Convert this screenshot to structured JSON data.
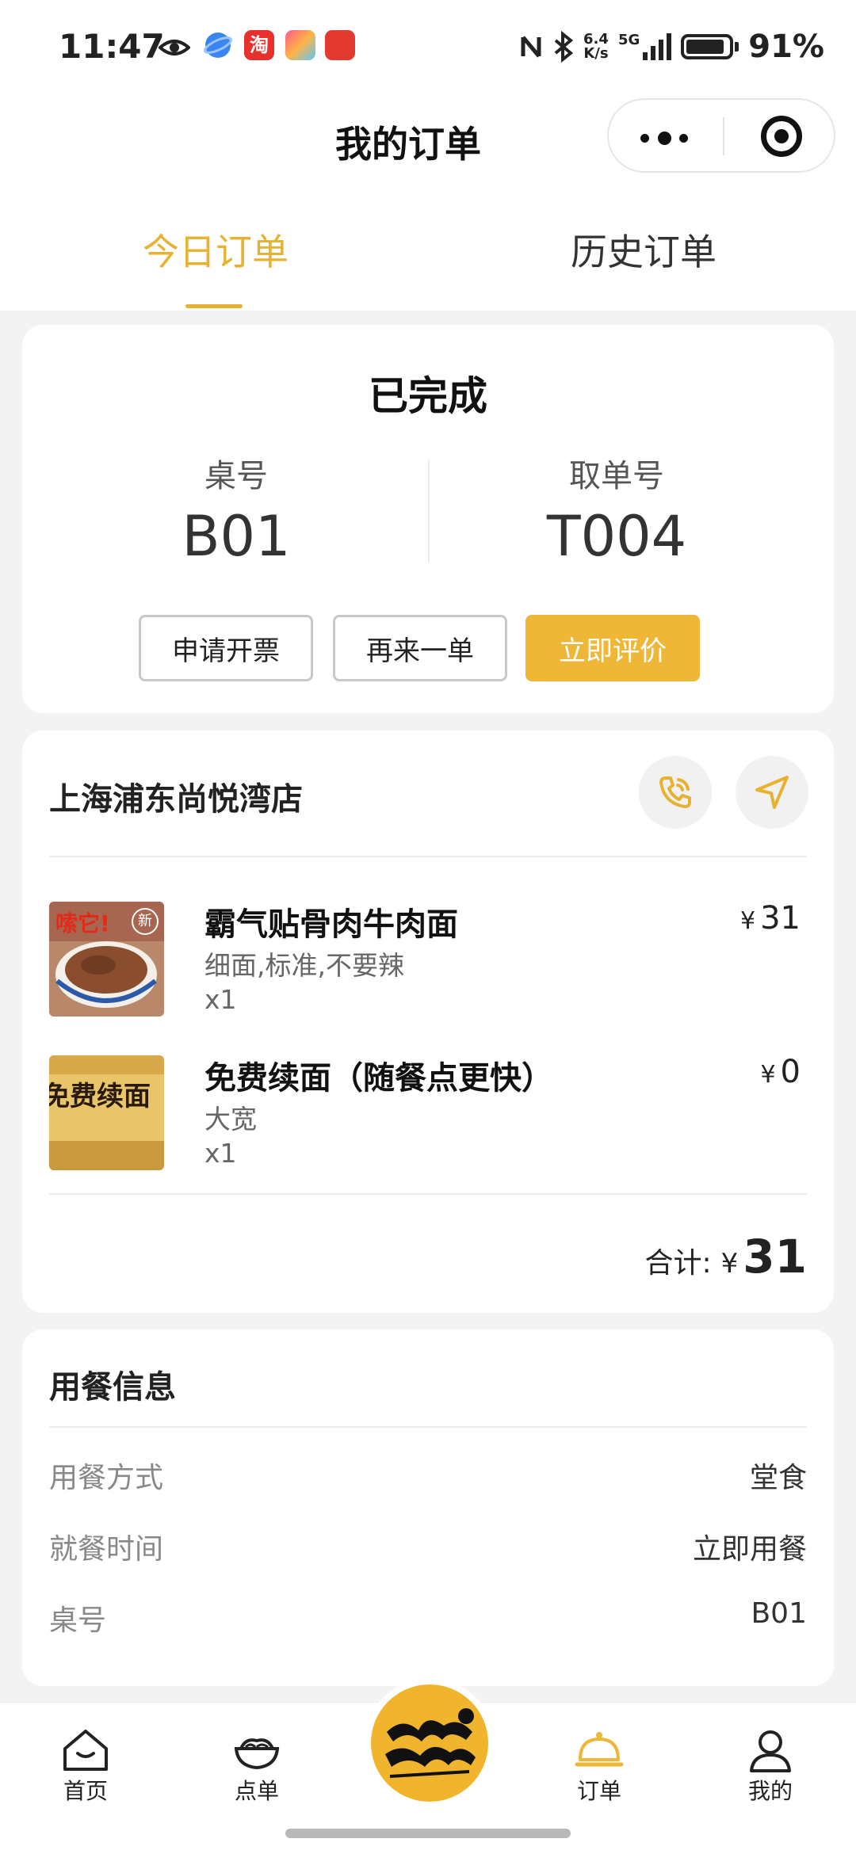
{
  "status_bar": {
    "time": "11:47",
    "net_speed_top": "6.4",
    "net_speed_bottom": "K/s",
    "signal": "5G",
    "battery": "91%",
    "icons": [
      "eye-icon",
      "browser-icon",
      "taobao-icon",
      "app-icon",
      "app-icon",
      "nfc-icon",
      "bluetooth-icon",
      "signal-icon",
      "battery-icon"
    ]
  },
  "nav": {
    "title": "我的订单"
  },
  "tabs": [
    {
      "label": "今日订单",
      "active": true
    },
    {
      "label": "历史订单",
      "active": false
    }
  ],
  "order_status": {
    "title": "已完成",
    "table_label": "桌号",
    "table_value": "B01",
    "pickup_label": "取单号",
    "pickup_value": "T004",
    "buttons": {
      "invoice": "申请开票",
      "reorder": "再来一单",
      "review": "立即评价"
    }
  },
  "store": {
    "name": "上海浦东尚悦湾店"
  },
  "items": [
    {
      "name": "霸气贴骨肉牛肉面",
      "spec": "细面,标准,不要辣",
      "qty": "x1",
      "currency": "¥",
      "price": "31",
      "image_text": "嗦它!",
      "badge": "新"
    },
    {
      "name": "免费续面（随餐点更快）",
      "spec": "大宽",
      "qty": "x1",
      "currency": "¥",
      "price": "0",
      "image_text": "免费续面"
    }
  ],
  "total": {
    "label": "合计:",
    "currency": "¥",
    "value": "31"
  },
  "dining": {
    "title": "用餐信息",
    "rows": [
      {
        "label": "用餐方式",
        "value": "堂食"
      },
      {
        "label": "就餐时间",
        "value": "立即用餐"
      },
      {
        "label": "桌号",
        "value": "B01"
      }
    ]
  },
  "bottom_nav": [
    {
      "label": "首页",
      "icon": "home-icon"
    },
    {
      "label": "点单",
      "icon": "bowl-icon"
    },
    {
      "label": "订单",
      "icon": "cloche-icon",
      "active": true
    },
    {
      "label": "我的",
      "icon": "user-icon"
    }
  ],
  "colors": {
    "accent": "#efb737",
    "accent_text": "#e7b232",
    "background": "#f3f3f3"
  }
}
